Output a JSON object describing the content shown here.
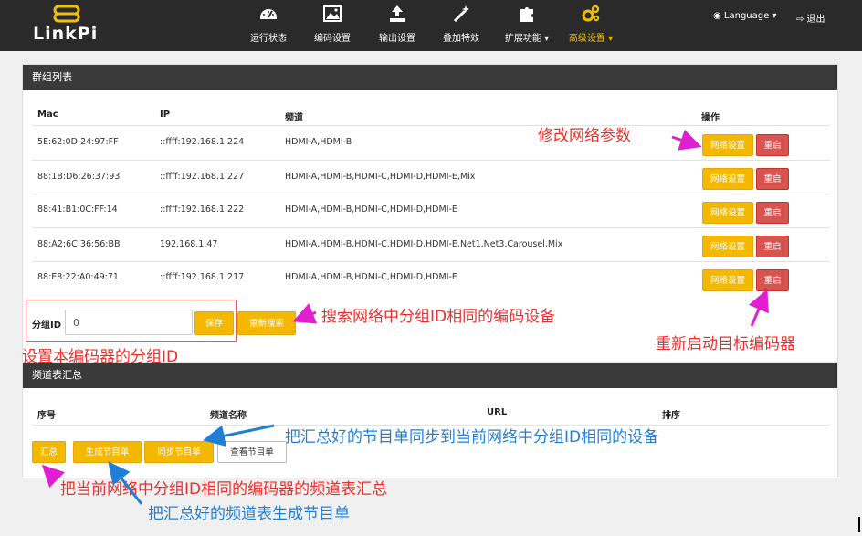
{
  "brand": {
    "name": "LinkPi"
  },
  "nav": {
    "items": [
      {
        "label": "运行状态",
        "icon": "dashboard-icon"
      },
      {
        "label": "编码设置",
        "icon": "image-icon"
      },
      {
        "label": "输出设置",
        "icon": "upload-icon"
      },
      {
        "label": "叠加特效",
        "icon": "magic-wand-icon"
      },
      {
        "label": "扩展功能 ▾",
        "icon": "puzzle-icon"
      },
      {
        "label": "高级设置 ▾",
        "icon": "gears-icon"
      }
    ],
    "language": "◉ Language ▾",
    "logout": "⇨ 退出",
    "active_color": "#f0c000"
  },
  "group_panel": {
    "title": "群组列表",
    "headers": {
      "mac": "Mac",
      "ip": "IP",
      "channel": "频道",
      "ops": "操作"
    },
    "rows": [
      {
        "mac": "5E:62:0D:24:97:FF",
        "ip": "::ffff:192.168.1.224",
        "channel": "HDMI-A,HDMI-B"
      },
      {
        "mac": "88:1B:D6:26:37:93",
        "ip": "::ffff:192.168.1.227",
        "channel": "HDMI-A,HDMI-B,HDMI-C,HDMI-D,HDMI-E,Mix"
      },
      {
        "mac": "88:41:B1:0C:FF:14",
        "ip": "::ffff:192.168.1.222",
        "channel": "HDMI-A,HDMI-B,HDMI-C,HDMI-D,HDMI-E"
      },
      {
        "mac": "88:A2:6C:36:56:BB",
        "ip": "192.168.1.47",
        "channel": "HDMI-A,HDMI-B,HDMI-C,HDMI-D,HDMI-E,Net1,Net3,Carousel,Mix"
      },
      {
        "mac": "88:E8:22:A0:49:71",
        "ip": "::ffff:192.168.1.217",
        "channel": "HDMI-A,HDMI-B,HDMI-C,HDMI-D,HDMI-E"
      }
    ],
    "net_button": "网络设置",
    "restart_button": "重启",
    "group_id_label": "分组ID",
    "group_id_value": "0",
    "save_button": "保存",
    "research_button": "重新搜索"
  },
  "channel_panel": {
    "title": "频道表汇总",
    "headers": {
      "index": "序号",
      "name": "频道名称",
      "url": "URL",
      "sort": "排序"
    },
    "buttons": {
      "summary": "汇总",
      "generate": "生成节目单",
      "sync": "同步节目单",
      "view": "查看节目单"
    }
  },
  "annotations": {
    "net_params": "修改网络参数",
    "search_devices": "搜索网络中分组ID相同的编码设备",
    "restart_target": "重新启动目标编码器",
    "set_group_id": "设置本编码器的分组ID",
    "sync_playlist": "把汇总好的节目单同步到当前网络中分组ID相同的设备",
    "summary_channels": "把当前网络中分组ID相同的编码器的频道表汇总",
    "generate_playlist": "把汇总好的频道表生成节目单"
  },
  "colors": {
    "accent": "#f5b800",
    "danger": "#d9534f",
    "annotation_red": "#e8302a",
    "annotation_blue": "#1f7fd8",
    "arrow_magenta": "#e020d0"
  }
}
